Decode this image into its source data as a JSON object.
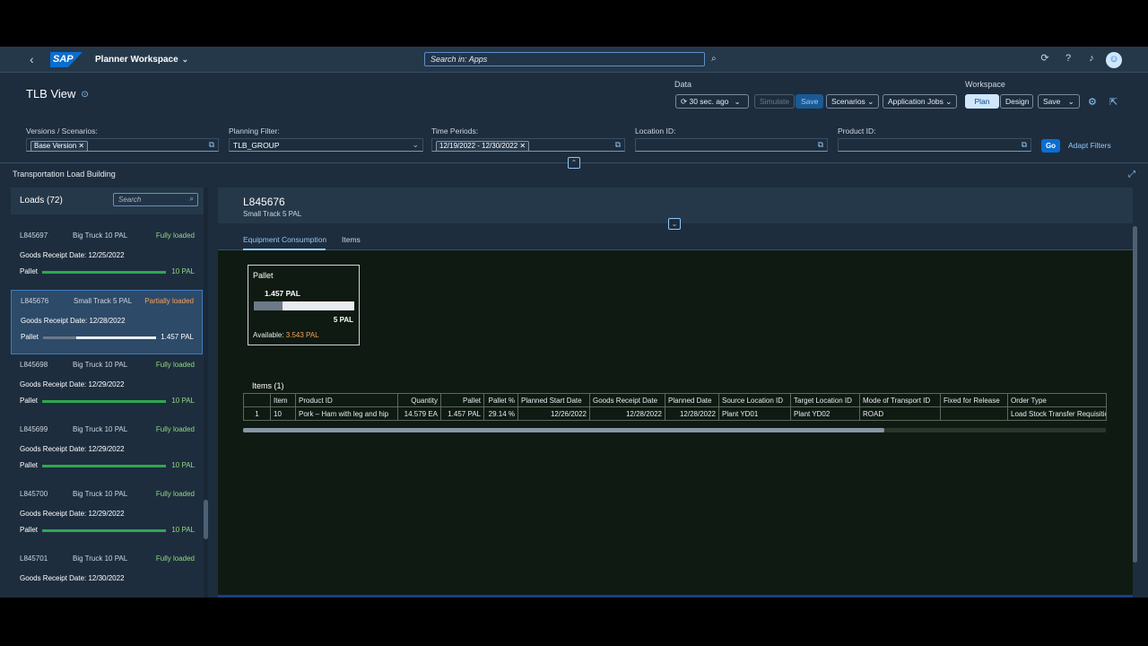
{
  "shell": {
    "back_icon": "chevron-left",
    "logo": "SAP",
    "app_title": "Planner Workspace",
    "search_placeholder": "Search in: Apps",
    "icons": [
      "refresh-icon",
      "help-icon",
      "bell-icon"
    ]
  },
  "page": {
    "title": "TLB View",
    "data_label": "Data",
    "workspace_label": "Workspace",
    "refresh_btn": "30 sec. ago",
    "simulate_btn": "Simulate",
    "save_btn": "Save",
    "scenarios_btn": "Scenarios",
    "appjobs_btn": "Application Jobs",
    "plan_btn": "Plan",
    "design_btn": "Design",
    "ws_save_btn": "Save"
  },
  "filters": {
    "versions_label": "Versions / Scenarios:",
    "versions_token": "Base Version",
    "planning_label": "Planning Filter:",
    "planning_value": "TLB_GROUP",
    "periods_label": "Time Periods:",
    "periods_token": "12/19/2022 - 12/30/2022",
    "location_label": "Location ID:",
    "product_label": "Product ID:",
    "go_btn": "Go",
    "adapt_btn": "Adapt Filters"
  },
  "section": {
    "title": "Transportation Load Building"
  },
  "loads": {
    "title": "Loads (72)",
    "search_placeholder": "Search",
    "items": [
      {
        "id": "L845697",
        "truck": "Big Truck 10 PAL",
        "status": "Fully loaded",
        "date": "Goods Receipt Date: 12/25/2022",
        "label": "Pallet",
        "value": "10 PAL",
        "fill": 1.0
      },
      {
        "id": "L845676",
        "truck": "Small Track 5 PAL",
        "status": "Partially loaded",
        "date": "Goods Receipt Date: 12/28/2022",
        "label": "Pallet",
        "value": "1.457 PAL",
        "fill": 0.29
      },
      {
        "id": "L845698",
        "truck": "Big Truck 10 PAL",
        "status": "Fully loaded",
        "date": "Goods Receipt Date: 12/29/2022",
        "label": "Pallet",
        "value": "10 PAL",
        "fill": 1.0
      },
      {
        "id": "L845699",
        "truck": "Big Truck 10 PAL",
        "status": "Fully loaded",
        "date": "Goods Receipt Date: 12/29/2022",
        "label": "Pallet",
        "value": "10 PAL",
        "fill": 1.0
      },
      {
        "id": "L845700",
        "truck": "Big Truck 10 PAL",
        "status": "Fully loaded",
        "date": "Goods Receipt Date: 12/29/2022",
        "label": "Pallet",
        "value": "10 PAL",
        "fill": 1.0
      },
      {
        "id": "L845701",
        "truck": "Big Truck 10 PAL",
        "status": "Fully loaded",
        "date": "Goods Receipt Date: 12/30/2022",
        "label": "Pallet",
        "value": "10 PAL",
        "fill": 1.0
      }
    ]
  },
  "detail": {
    "title": "L845676",
    "subtitle": "Small Track 5 PAL",
    "tabs": [
      "Equipment Consumption",
      "Items"
    ],
    "card": {
      "title": "Pallet",
      "value": "1.457 PAL",
      "fill": 0.29,
      "capacity": "5 PAL",
      "available_label": "Available:",
      "available_value": "3.543 PAL"
    },
    "items_title": "Items (1)",
    "table": {
      "headers": [
        "",
        "Item",
        "Product ID",
        "Quantity",
        "Pallet",
        "Pallet %",
        "Planned Start Date",
        "Goods Receipt Date",
        "Planned Date",
        "Source Location ID",
        "Target Location ID",
        "Mode of Transport ID",
        "Fixed for Release",
        "Order Type"
      ],
      "rows": [
        [
          "1",
          "10",
          "Pork – Ham with leg and hip",
          "14.579 EA",
          "1.457 PAL",
          "29.14 %",
          "12/26/2022",
          "12/28/2022",
          "12/28/2022",
          "Plant YD01",
          "Plant YD02",
          "ROAD",
          "",
          "Load Stock Transfer Requisition"
        ]
      ]
    }
  }
}
